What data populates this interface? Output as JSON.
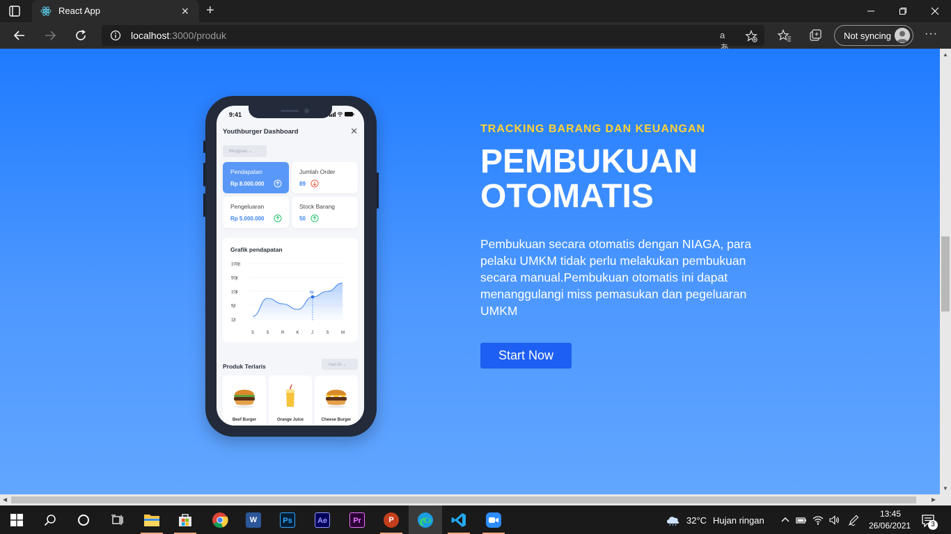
{
  "browser": {
    "tab_title": "React App",
    "url_host": "localhost",
    "url_rest": ":3000/produk",
    "sync_label": "Not syncing"
  },
  "phone": {
    "status_time": "9:41",
    "dashboard_title": "Youthburger Dashboard",
    "filter_label": "Mingguan",
    "cards": [
      {
        "label": "Pendapatan",
        "value": "Rp 8.000.000",
        "trend": "up"
      },
      {
        "label": "Jumlah Order",
        "value": "89",
        "trend": "down"
      },
      {
        "label": "Pengeluaran",
        "value": "Rp 5.000.000",
        "trend": "up"
      },
      {
        "label": "Stock Barang",
        "value": "50",
        "trend": "up"
      }
    ],
    "chart_title": "Grafik pendapatan",
    "chart_highlight_label": "8jt",
    "products_title": "Produk Terlaris",
    "products_filter": "Hari ini",
    "products": [
      {
        "name": "Beef Burger"
      },
      {
        "name": "Orange Juice"
      },
      {
        "name": "Cheese Burger"
      }
    ]
  },
  "chart_data": {
    "type": "area",
    "title": "Grafik pendapatan",
    "x": [
      "S",
      "S",
      "R",
      "K",
      "J",
      "S",
      "M"
    ],
    "y_tick_labels": [
      "100jt",
      "50jt",
      "10jt",
      "5jt",
      "1jt"
    ],
    "series": [
      {
        "values": [
          0.2,
          1.5,
          1.1,
          0.7,
          1.6,
          2.0,
          2.6
        ]
      }
    ],
    "highlight": {
      "x": "J",
      "label": "8jt"
    },
    "grid": true
  },
  "hero": {
    "tag": "TRACKING BARANG DAN KEUANGAN",
    "title": "PEMBUKUAN OTOMATIS",
    "description": "Pembukuan secara otomatis dengan NIAGA, para pelaku UMKM tidak perlu melakukan pembukuan secara manual.Pembukuan otomatis ini dapat menanggulangi miss pemasukan dan pegeluaran UMKM",
    "cta_label": "Start Now"
  },
  "taskbar": {
    "weather_temp": "32°C",
    "weather_text": "Hujan ringan",
    "time": "13:45",
    "date": "26/06/2021",
    "notification_count": "3",
    "apps": [
      {
        "name": "file-explorer",
        "label": ""
      },
      {
        "name": "microsoft-store",
        "label": ""
      },
      {
        "name": "chrome",
        "label": ""
      },
      {
        "name": "word",
        "label": "W"
      },
      {
        "name": "photoshop",
        "label": "Ps"
      },
      {
        "name": "after-effects",
        "label": "Ae"
      },
      {
        "name": "premiere",
        "label": "Pr"
      },
      {
        "name": "powerpoint",
        "label": "P"
      },
      {
        "name": "edge",
        "label": ""
      },
      {
        "name": "vscode",
        "label": ""
      },
      {
        "name": "zoom",
        "label": ""
      }
    ]
  },
  "colors": {
    "accent": "#1f7bff",
    "cta": "#1d5ff2",
    "tag": "#ffd233"
  }
}
